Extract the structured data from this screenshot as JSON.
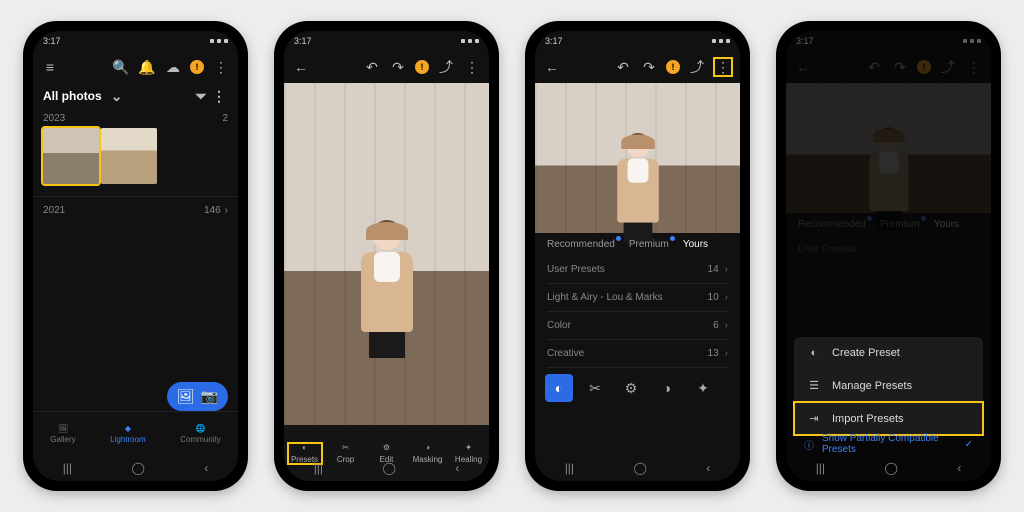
{
  "status_time": "3:17",
  "phone1": {
    "title": "All photos",
    "years": [
      {
        "label": "2023",
        "count": "2"
      },
      {
        "label": "2021",
        "count": "146"
      }
    ],
    "tabs": [
      {
        "label": "Gallery"
      },
      {
        "label": "Lightroom"
      },
      {
        "label": "Community"
      }
    ]
  },
  "phone2": {
    "tools": [
      {
        "label": "Presets"
      },
      {
        "label": "Crop"
      },
      {
        "label": "Edit"
      },
      {
        "label": "Masking"
      },
      {
        "label": "Healing"
      }
    ]
  },
  "phone3": {
    "preset_tabs": [
      {
        "label": "Recommended"
      },
      {
        "label": "Premium"
      },
      {
        "label": "Yours"
      }
    ],
    "preset_groups": [
      {
        "name": "User Presets",
        "count": "14"
      },
      {
        "name": "Light & Airy - Lou & Marks",
        "count": "10"
      },
      {
        "name": "Color",
        "count": "6"
      },
      {
        "name": "Creative",
        "count": "13"
      }
    ]
  },
  "phone4": {
    "preset_tabs": [
      {
        "label": "Recommended"
      },
      {
        "label": "Premium"
      },
      {
        "label": "Yours"
      }
    ],
    "groups_hint": "User Presets",
    "menu": [
      {
        "label": "Create Preset"
      },
      {
        "label": "Manage Presets"
      },
      {
        "label": "Import Presets"
      }
    ],
    "footer_option": "Show Partially Compatible Presets"
  }
}
